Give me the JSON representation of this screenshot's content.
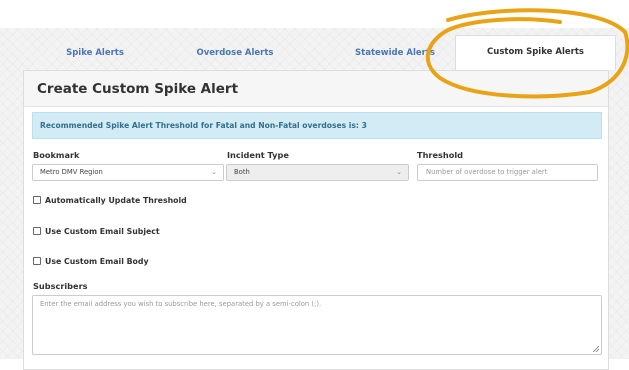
{
  "tabs": [
    {
      "label": "Spike Alerts"
    },
    {
      "label": "Overdose Alerts"
    },
    {
      "label": "Statewide Alerts"
    },
    {
      "label": "Custom Spike Alerts",
      "active": true
    }
  ],
  "card": {
    "title": "Create Custom Spike Alert",
    "alert": "Recommended Spike Alert Threshold for Fatal and Non-Fatal overdoses is: 3"
  },
  "form": {
    "bookmark": {
      "label": "Bookmark",
      "value": "Metro DMV Region",
      "icon": "chevron-down-icon"
    },
    "incident_type": {
      "label": "Incident Type",
      "value": "Both",
      "icon": "chevron-down-icon"
    },
    "threshold": {
      "label": "Threshold",
      "placeholder": "Number of overdose to trigger alert"
    },
    "checkboxes": [
      {
        "label": "Automatically Update Threshold",
        "checked": false
      },
      {
        "label": "Use Custom Email Subject",
        "checked": false
      },
      {
        "label": "Use Custom Email Body",
        "checked": false
      }
    ],
    "subscribers": {
      "label": "Subscribers",
      "placeholder": "Enter the email address you wish to subscribe here, separated by a semi-colon (;)."
    }
  },
  "colors": {
    "tab_link": "#4a76b4",
    "alert_bg": "#d3ebf4",
    "alert_text": "#31708f",
    "highlight_circle": "#e8a317"
  }
}
